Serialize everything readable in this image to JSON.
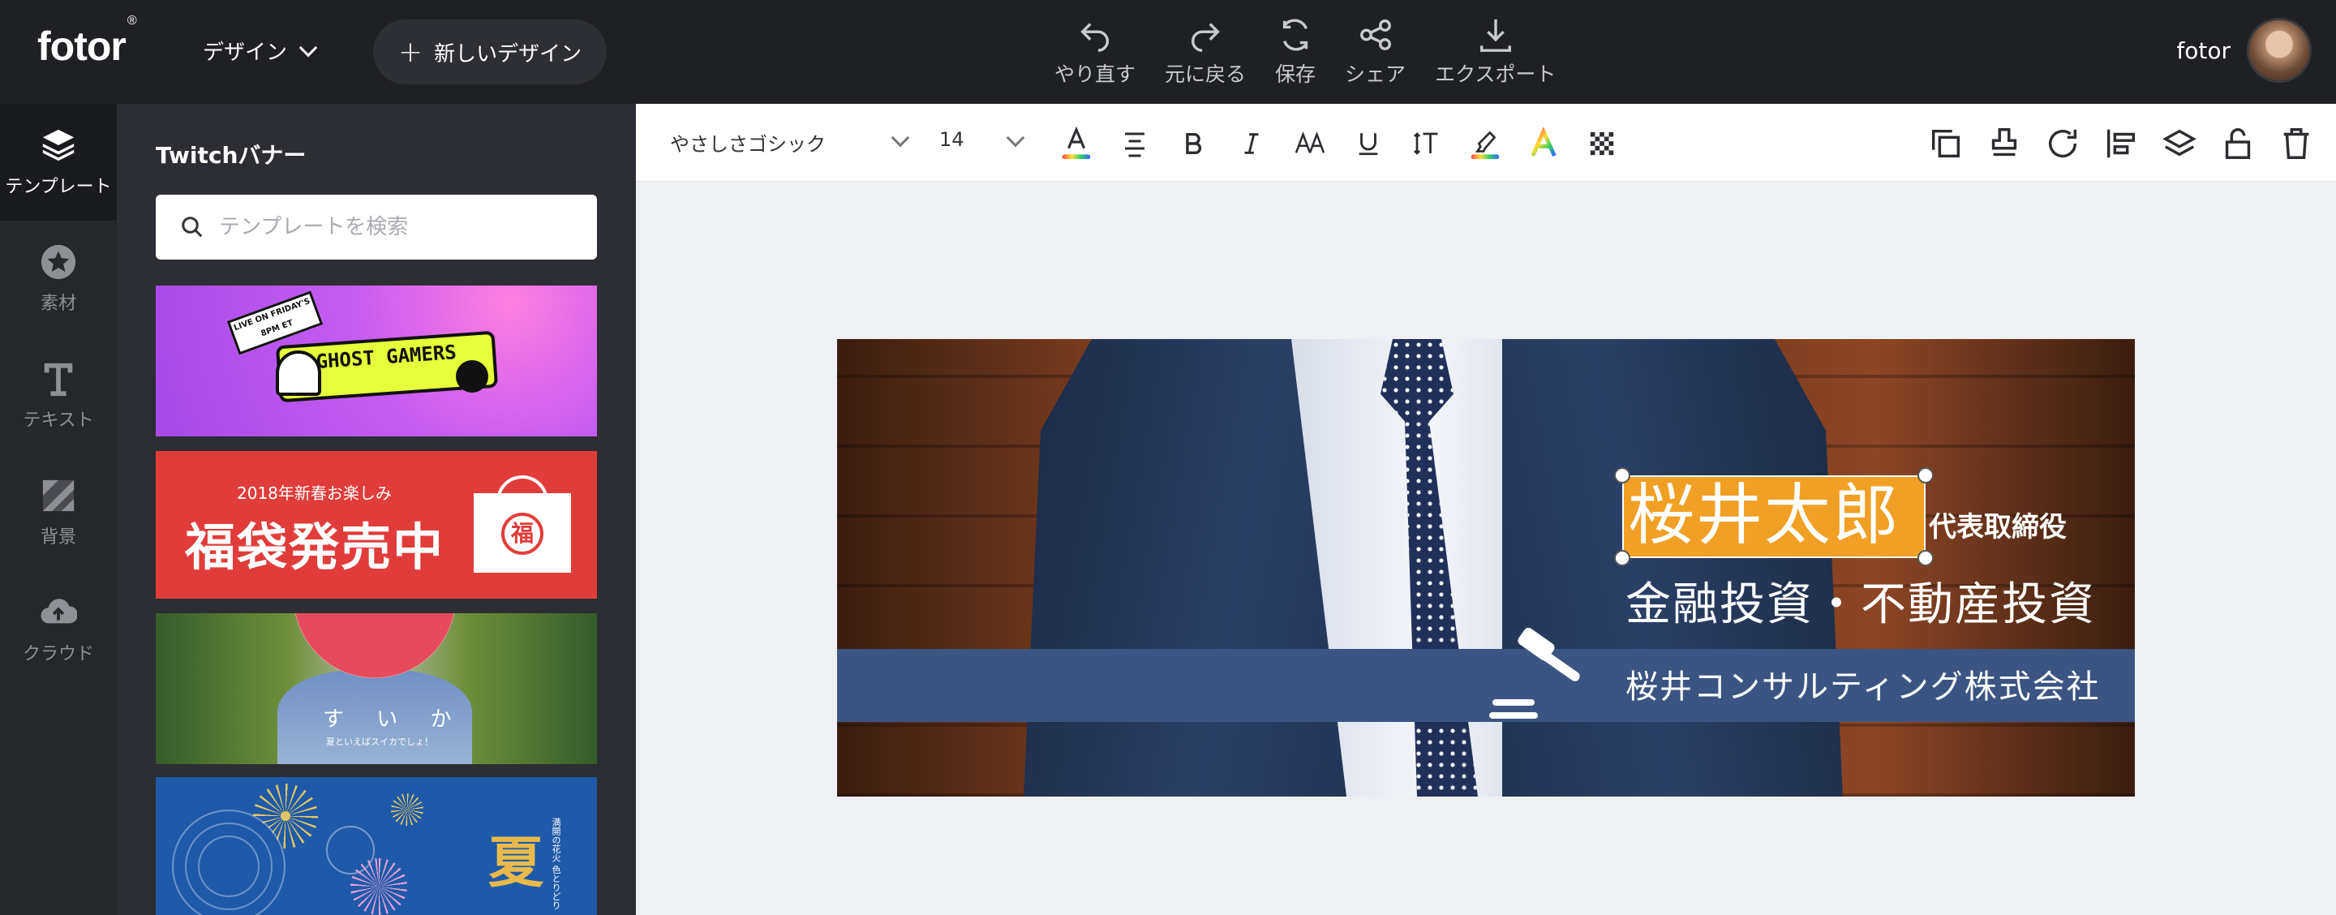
{
  "app": {
    "logo": "fotor",
    "logo_mark": "®",
    "design_menu": "デザイン",
    "new_design": "新しいデザイン",
    "user_name": "fotor"
  },
  "toolbar": {
    "actions": [
      {
        "label": "やり直す",
        "icon": "undo-icon"
      },
      {
        "label": "元に戻る",
        "icon": "redo-icon"
      },
      {
        "label": "保存",
        "icon": "save-icon"
      },
      {
        "label": "シェア",
        "icon": "share-icon"
      },
      {
        "label": "エクスポート",
        "icon": "export-icon"
      }
    ]
  },
  "sidebar": {
    "items": [
      {
        "label": "テンプレート",
        "icon": "layers-icon",
        "active": true
      },
      {
        "label": "素材",
        "icon": "star-icon"
      },
      {
        "label": "テキスト",
        "icon": "text-icon"
      },
      {
        "label": "背景",
        "icon": "background-icon"
      },
      {
        "label": "クラウド",
        "icon": "cloud-upload-icon"
      }
    ]
  },
  "panel": {
    "title": "Twitchバナー",
    "search_placeholder": "テンプレートを検索",
    "templates": {
      "t1_live": "LIVE ON FRIDAY'S 8PM ET",
      "t1_title": "GHOST GAMERS",
      "t2_sub": "2018年新春お楽しみ",
      "t2_main": "福袋発売中",
      "t2_badge": "福",
      "t3_title": "す い か",
      "t3_sub": "夏といえばスイカでしょ！",
      "t4_title": "夏",
      "t4_side": "満開の花火 色とりどり"
    }
  },
  "format_bar": {
    "font": "やさしさゴシック",
    "size": "14",
    "icons": [
      "text-color-icon",
      "align-icon",
      "bold-icon",
      "italic-icon",
      "letter-case-icon",
      "underline-icon",
      "line-spacing-icon",
      "highlight-icon",
      "gradient-text-icon",
      "transparency-icon"
    ],
    "right_icons": [
      "duplicate-icon",
      "stamp-icon",
      "rotate-icon",
      "align-left-icon",
      "layers-icon",
      "unlock-icon",
      "delete-icon"
    ]
  },
  "canvas": {
    "name": "桜井太郎",
    "title": "代表取締役",
    "business": "金融投資・不動産投資",
    "company": "桜井コンサルティング株式会社"
  }
}
